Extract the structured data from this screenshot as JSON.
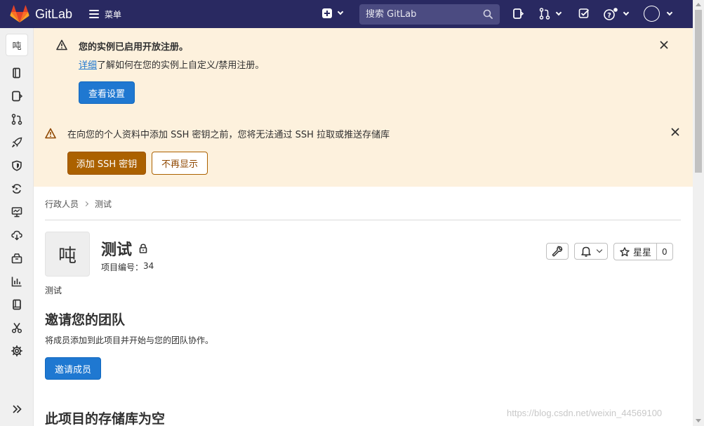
{
  "navbar": {
    "brand": "GitLab",
    "menu_label": "菜单",
    "search_placeholder": "搜索 GitLab"
  },
  "sidebar": {
    "project_initial": "吨",
    "icons": [
      "project-overview-icon",
      "issues-icon",
      "merge-requests-icon",
      "ci-cd-icon",
      "security-icon",
      "deployments-icon",
      "monitor-icon",
      "infrastructure-icon",
      "packages-icon",
      "analytics-icon",
      "wiki-icon",
      "snippets-icon",
      "settings-icon"
    ],
    "collapse_icon": "chevron-double-right-icon"
  },
  "alert_registration": {
    "title": "您的实例已启用开放注册。",
    "link_text": "详细",
    "body_text": "了解如何在您的实例上自定义/禁用注册。",
    "button_label": "查看设置"
  },
  "alert_ssh": {
    "text": "在向您的个人资料中添加 SSH 密钥之前，您将无法通过 SSH 拉取或推送存储库",
    "add_key_label": "添加 SSH 密钥",
    "dismiss_label": "不再显示"
  },
  "breadcrumb": {
    "parent": "行政人员",
    "current": "测试"
  },
  "project": {
    "initial": "吨",
    "name": "测试",
    "id_label": "项目编号：",
    "id_value": "34",
    "description": "测试",
    "star_label": "星星",
    "star_count": "0"
  },
  "invite": {
    "title": "邀请您的团队",
    "text": "将成员添加到此项目并开始与您的团队协作。",
    "button_label": "邀请成员"
  },
  "empty_repo": {
    "title": "此项目的存储库为空"
  },
  "watermark": "https://blog.csdn.net/weixin_44569100",
  "colors": {
    "navbar": "#292961",
    "alert_bg": "#fdf1dd",
    "primary": "#1f78d1",
    "warning": "#ab6100"
  }
}
